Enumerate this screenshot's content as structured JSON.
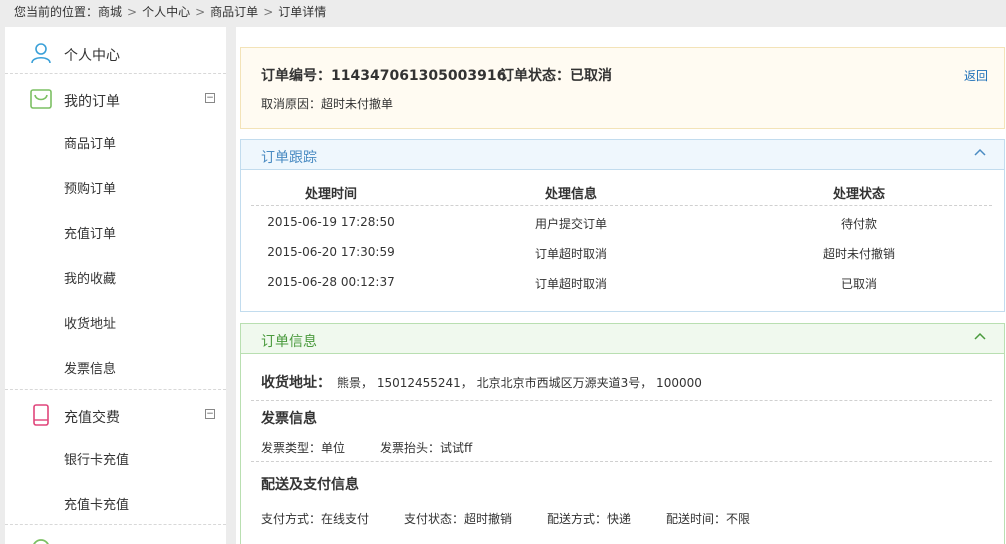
{
  "breadcrumb": {
    "prefix": "您当前的位置：",
    "items": [
      "商城",
      "个人中心",
      "商品订单",
      "订单详情"
    ],
    "sep": ">"
  },
  "sidebar": {
    "personal_center": "个人中心",
    "my_orders": {
      "title": "我的订单",
      "toggle": "−",
      "items": [
        "商品订单",
        "预购订单",
        "充值订单",
        "我的收藏",
        "收货地址",
        "发票信息"
      ]
    },
    "recharge": {
      "title": "充值交费",
      "toggle": "−",
      "items": [
        "银行卡充值",
        "充值卡充值"
      ]
    }
  },
  "order": {
    "number_label": "订单编号：",
    "number": "114347061305003916",
    "status_label": "订单状态：",
    "status": "已取消",
    "back": "返回",
    "reason_label": "取消原因：",
    "reason": "超时未付撤单"
  },
  "tracking": {
    "title": "订单跟踪",
    "columns": [
      "处理时间",
      "处理信息",
      "处理状态"
    ],
    "rows": [
      [
        "2015-06-19 17:28:50",
        "用户提交订单",
        "待付款"
      ],
      [
        "2015-06-20 17:30:59",
        "订单超时取消",
        "超时未付撤销"
      ],
      [
        "2015-06-28 00:12:37",
        "订单超时取消",
        "已取消"
      ]
    ]
  },
  "info": {
    "title": "订单信息",
    "address_label": "收货地址：",
    "address": "熊景， 15012455241， 北京北京市西城区万源夹道3号， 100000",
    "invoice_title": "发票信息",
    "invoice_type_label": "发票类型：",
    "invoice_type": "单位",
    "invoice_head_label": "发票抬头：",
    "invoice_head": "试试ff",
    "delivery_title": "配送及支付信息",
    "pay_method_label": "支付方式：",
    "pay_method": "在线支付",
    "pay_status_label": "支付状态：",
    "pay_status": "超时撤销",
    "ship_method_label": "配送方式：",
    "ship_method": "快递",
    "ship_time_label": "配送时间：",
    "ship_time": "不限"
  },
  "colors": {
    "accent_blue": "#1c6fb8",
    "green": "#4a9a3d",
    "pink": "#e0457b",
    "cyan": "#3aa0d8"
  }
}
